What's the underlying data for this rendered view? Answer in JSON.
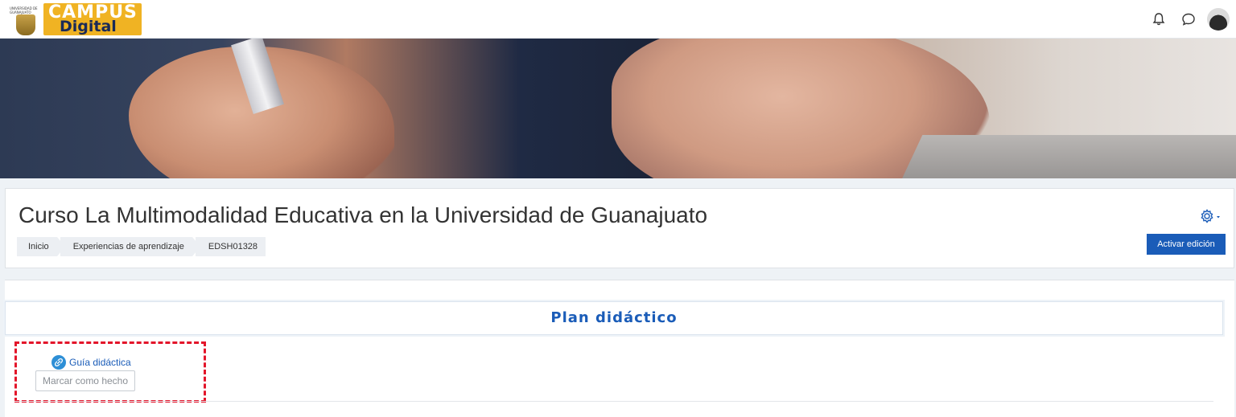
{
  "navbar": {
    "university_text": "UNIVERSIDAD DE GUANAJUATO",
    "logo_top": "CAMPUS",
    "logo_bottom": "Digital",
    "icons": [
      "bell-icon",
      "chat-icon",
      "avatar"
    ]
  },
  "header": {
    "title": "Curso La Multimodalidad Educativa en la Universidad de Guanajuato",
    "breadcrumb": [
      "Inicio",
      "Experiencias de aprendizaje",
      "EDSH01328"
    ],
    "edit_button": "Activar edición"
  },
  "section": {
    "title": "Plan didáctico",
    "activity_label": "Guía didáctica",
    "complete_button": "Marcar como hecho"
  },
  "colors": {
    "accent": "#1a5cb8",
    "highlight_border": "#e3152a",
    "logo_bg": "#f0b323"
  }
}
